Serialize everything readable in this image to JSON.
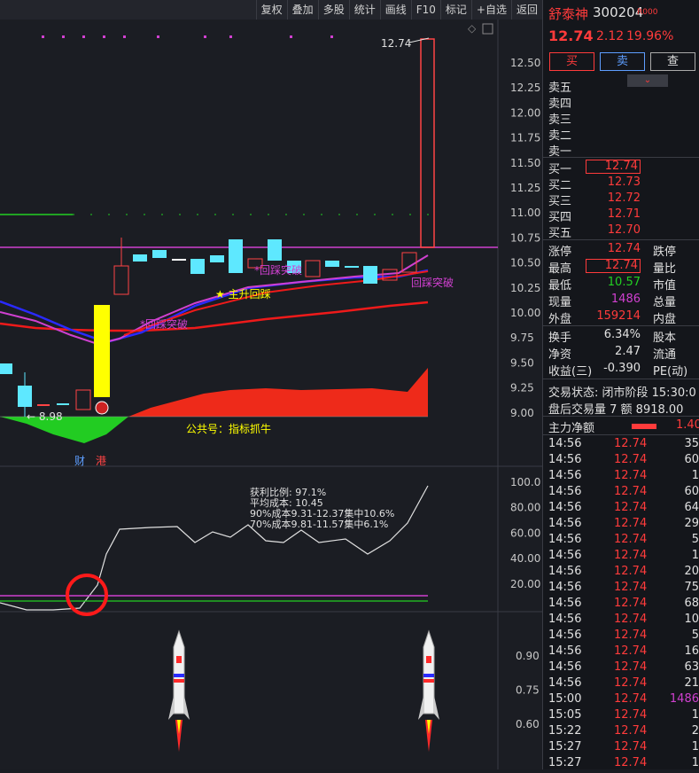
{
  "toolbar": [
    "复权",
    "叠加",
    "多股",
    "统计",
    "画线",
    "F10",
    "标记",
    "+自选",
    "返回"
  ],
  "stock": {
    "name": "舒泰神",
    "code": "300204",
    "tag": "R000",
    "price": "12.74",
    "change": "2.12",
    "pct": "19.96%"
  },
  "actions": {
    "buy": "买",
    "sell": "卖",
    "query": "查"
  },
  "sell_levels": [
    "卖五",
    "卖四",
    "卖三",
    "卖二",
    "卖一"
  ],
  "buy_levels": [
    {
      "label": "买一",
      "price": "12.74"
    },
    {
      "label": "买二",
      "price": "12.73"
    },
    {
      "label": "买三",
      "price": "12.72"
    },
    {
      "label": "买四",
      "price": "12.71"
    },
    {
      "label": "买五",
      "price": "12.70"
    }
  ],
  "stats": [
    {
      "l1": "涨停",
      "v1": "12.74",
      "l2": "跌停"
    },
    {
      "l1": "最高",
      "v1": "12.74",
      "l2": "量比"
    },
    {
      "l1": "最低",
      "v1": "10.57",
      "l2": "市值"
    },
    {
      "l1": "现量",
      "v1": "1486",
      "l2": "总量"
    },
    {
      "l1": "外盘",
      "v1": "159214",
      "l2": "内盘"
    }
  ],
  "stats2": [
    {
      "l1": "换手",
      "v1": "6.34%",
      "l2": "股本"
    },
    {
      "l1": "净资",
      "v1": "2.47",
      "l2": "流通"
    },
    {
      "l1": "收益(三)",
      "v1": "-0.390",
      "l2": "PE(动)"
    }
  ],
  "trade_status": "交易状态: 闭市阶段 15:30:0",
  "after_hours": "盘后交易量 7 额 8918.00",
  "main_flow": {
    "label": "主力净额",
    "value": "1.40"
  },
  "ticks": [
    {
      "t": "14:56",
      "p": "12.74",
      "v": "35"
    },
    {
      "t": "14:56",
      "p": "12.74",
      "v": "60"
    },
    {
      "t": "14:56",
      "p": "12.74",
      "v": "1"
    },
    {
      "t": "14:56",
      "p": "12.74",
      "v": "60"
    },
    {
      "t": "14:56",
      "p": "12.74",
      "v": "64"
    },
    {
      "t": "14:56",
      "p": "12.74",
      "v": "29"
    },
    {
      "t": "14:56",
      "p": "12.74",
      "v": "5"
    },
    {
      "t": "14:56",
      "p": "12.74",
      "v": "1"
    },
    {
      "t": "14:56",
      "p": "12.74",
      "v": "20"
    },
    {
      "t": "14:56",
      "p": "12.74",
      "v": "75"
    },
    {
      "t": "14:56",
      "p": "12.74",
      "v": "68"
    },
    {
      "t": "14:56",
      "p": "12.74",
      "v": "10"
    },
    {
      "t": "14:56",
      "p": "12.74",
      "v": "5"
    },
    {
      "t": "14:56",
      "p": "12.74",
      "v": "16"
    },
    {
      "t": "14:56",
      "p": "12.74",
      "v": "63"
    },
    {
      "t": "14:56",
      "p": "12.74",
      "v": "21"
    },
    {
      "t": "15:00",
      "p": "12.74",
      "v": "1486"
    },
    {
      "t": "15:05",
      "p": "12.74",
      "v": "1"
    },
    {
      "t": "15:22",
      "p": "12.74",
      "v": "2"
    },
    {
      "t": "15:27",
      "p": "12.74",
      "v": "1"
    },
    {
      "t": "15:27",
      "p": "12.74",
      "v": "1"
    }
  ],
  "chart": {
    "y_ticks": [
      "12.50",
      "12.25",
      "12.00",
      "11.75",
      "11.50",
      "11.25",
      "11.00",
      "10.75",
      "10.50",
      "10.25",
      "10.00",
      "9.75",
      "9.50",
      "9.25",
      "9.00"
    ],
    "high_label": "12.74",
    "low_label": "8.98",
    "annotations": [
      "*回踩突破",
      "*回踩突破",
      "回踩突破",
      "★ 主升回踩"
    ],
    "gzh": "公共号：指标抓牛",
    "markers": [
      "财",
      "港"
    ],
    "cost_info": [
      "获利比例: 97.1%",
      "平均成本: 10.45",
      "90%成本9.31-12.37集中10.6%",
      "70%成本9.81-11.57集中6.1%"
    ],
    "y2_ticks": [
      "100.0",
      "80.00",
      "60.00",
      "40.00",
      "20.00"
    ],
    "y3_ticks": [
      "0.90",
      "0.75",
      "0.60"
    ]
  }
}
